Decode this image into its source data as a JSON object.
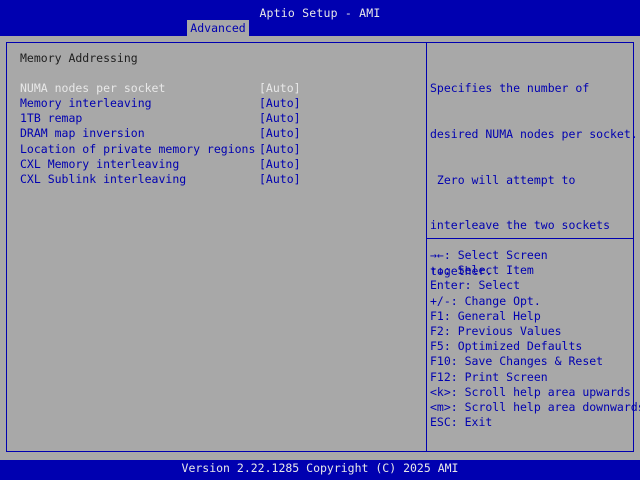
{
  "header": {
    "title": "Aptio Setup - AMI",
    "active_tab": "Advanced"
  },
  "section": {
    "title": "Memory Addressing"
  },
  "settings": [
    {
      "label": "NUMA nodes per socket",
      "value": "[Auto]",
      "selected": true
    },
    {
      "label": "Memory interleaving",
      "value": "[Auto]"
    },
    {
      "label": "1TB remap",
      "value": "[Auto]"
    },
    {
      "label": "DRAM map inversion",
      "value": "[Auto]"
    },
    {
      "label": "Location of private memory regions",
      "value": "[Auto]"
    },
    {
      "label": "CXL Memory interleaving",
      "value": "[Auto]"
    },
    {
      "label": "CXL Sublink interleaving",
      "value": "[Auto]"
    }
  ],
  "help": {
    "lines": [
      "Specifies the number of",
      "desired NUMA nodes per socket.",
      " Zero will attempt to",
      "interleave the two sockets",
      "together."
    ]
  },
  "keys": [
    "→←: Select Screen",
    "↑↓: Select Item",
    "Enter: Select",
    "+/-: Change Opt.",
    "F1: General Help",
    "F2: Previous Values",
    "F5: Optimized Defaults",
    "F10: Save Changes & Reset",
    "F12: Print Screen",
    "<k>: Scroll help area upwards",
    "<m>: Scroll help area downwards",
    "ESC: Exit"
  ],
  "footer": {
    "version": "Version 2.22.1285 Copyright (C) 2025 AMI"
  },
  "colors": {
    "background": "#a8a8a8",
    "accent": "#0000b0",
    "highlight_text": "#e8e8e8"
  }
}
